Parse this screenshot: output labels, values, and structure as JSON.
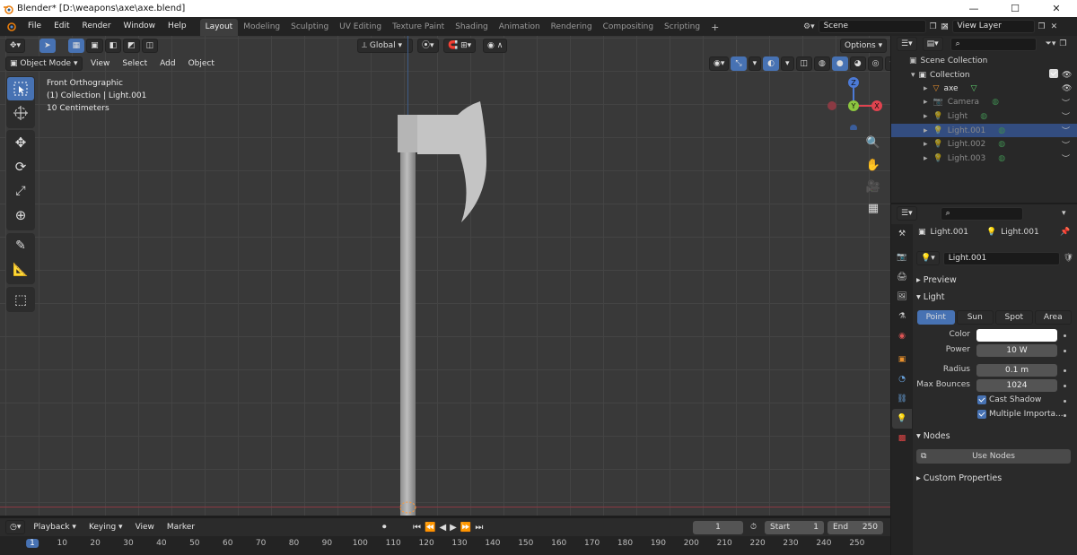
{
  "window": {
    "title": "Blender* [D:\\weapons\\axe\\axe.blend]"
  },
  "menu": [
    "File",
    "Edit",
    "Render",
    "Window",
    "Help"
  ],
  "workspaces": [
    "Layout",
    "Modeling",
    "Sculpting",
    "UV Editing",
    "Texture Paint",
    "Shading",
    "Animation",
    "Rendering",
    "Compositing",
    "Scripting"
  ],
  "scene": {
    "name": "Scene",
    "view_layer": "View Layer"
  },
  "viewport": {
    "mode": "Object Mode",
    "menus": [
      "View",
      "Select",
      "Add",
      "Object"
    ],
    "transform_orientation": "Global",
    "options_label": "Options",
    "view_name": "Front Orthographic",
    "collection_info": "(1) Collection | Light.001",
    "scale_info": "10 Centimeters",
    "gizmo": {
      "z": "Z",
      "y": "Y",
      "x": "X"
    }
  },
  "timeline": {
    "menus": [
      "Playback",
      "Keying",
      "View",
      "Marker"
    ],
    "current_frame": "1",
    "start_label": "Start",
    "start": "1",
    "end_label": "End",
    "end": "250",
    "ticks": [
      "1",
      "10",
      "20",
      "30",
      "40",
      "50",
      "60",
      "70",
      "80",
      "90",
      "100",
      "110",
      "120",
      "130",
      "140",
      "150",
      "160",
      "170",
      "180",
      "190",
      "200",
      "210",
      "220",
      "230",
      "240",
      "250"
    ]
  },
  "outliner": {
    "scene_collection": "Scene Collection",
    "collection": "Collection",
    "items": [
      {
        "name": "axe",
        "selected": false,
        "dim": false
      },
      {
        "name": "Camera",
        "selected": false,
        "dim": true
      },
      {
        "name": "Light",
        "selected": false,
        "dim": true
      },
      {
        "name": "Light.001",
        "selected": true,
        "dim": true
      },
      {
        "name": "Light.002",
        "selected": false,
        "dim": true
      },
      {
        "name": "Light.003",
        "selected": false,
        "dim": true
      }
    ]
  },
  "properties": {
    "object_name": "Light.001",
    "data_name": "Light.001",
    "datablock": "Light.001",
    "panels": {
      "preview": "Preview",
      "light": "Light",
      "nodes": "Nodes",
      "custom": "Custom Properties"
    },
    "light_types": [
      "Point",
      "Sun",
      "Spot",
      "Area"
    ],
    "active_type": "Point",
    "labels": {
      "color": "Color",
      "power": "Power",
      "radius": "Radius",
      "max_bounces": "Max Bounces"
    },
    "values": {
      "power": "10 W",
      "radius": "0.1 m",
      "max_bounces": "1024"
    },
    "color_value": "#ffffff",
    "checkboxes": {
      "cast_shadow": "Cast Shadow",
      "multiple_importance": "Multiple Importa..."
    },
    "use_nodes": "Use Nodes"
  },
  "colors": {
    "accent": "#4772b3",
    "selected_row": "#334d80"
  }
}
